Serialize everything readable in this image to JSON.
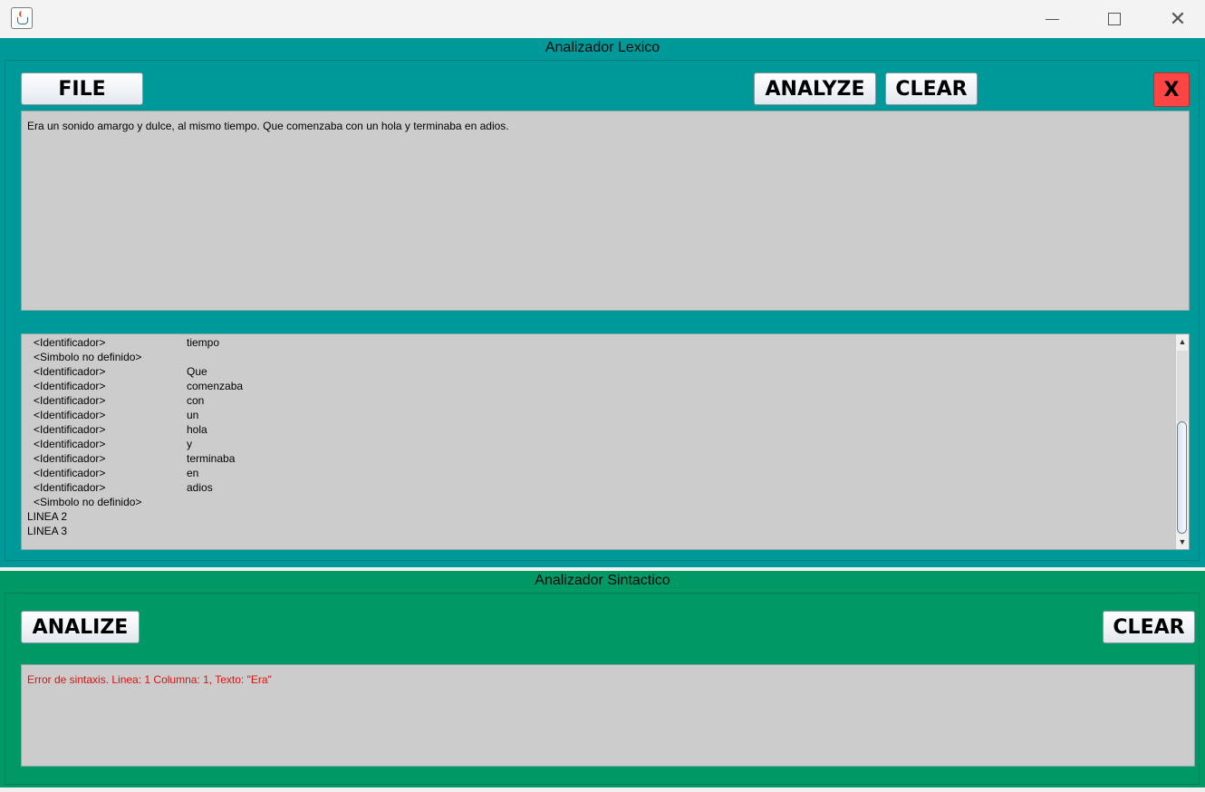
{
  "window": {
    "icon": "java-cup-icon",
    "controls": {
      "minimize": "minimize-icon",
      "maximize": "maximize-icon",
      "close": "close-icon"
    }
  },
  "lexico": {
    "title": "Analizador Lexico",
    "file_label": "FILE",
    "analyze_label": "ANALYZE",
    "clear_label": "CLEAR",
    "close_label": "X",
    "input_text": "Era un sonido amargo y dulce, al mismo tiempo. Que comenzaba con un hola y terminaba en adios.",
    "output_rows": [
      {
        "token": "<Identificador>",
        "value": "tiempo",
        "indent": true
      },
      {
        "token": "<Simbolo no definido>",
        "value": "",
        "indent": true
      },
      {
        "token": "<Identificador>",
        "value": "Que",
        "indent": true
      },
      {
        "token": "<Identificador>",
        "value": "comenzaba",
        "indent": true
      },
      {
        "token": "<Identificador>",
        "value": "con",
        "indent": true
      },
      {
        "token": "<Identificador>",
        "value": "un",
        "indent": true
      },
      {
        "token": "<Identificador>",
        "value": "hola",
        "indent": true
      },
      {
        "token": "<Identificador>",
        "value": "y",
        "indent": true
      },
      {
        "token": "<Identificador>",
        "value": "terminaba",
        "indent": true
      },
      {
        "token": "<Identificador>",
        "value": "en",
        "indent": true
      },
      {
        "token": "<Identificador>",
        "value": "adios",
        "indent": true
      },
      {
        "token": "<Simbolo no definido>",
        "value": "",
        "indent": true
      },
      {
        "token": "LINEA 2",
        "value": "",
        "indent": false
      },
      {
        "token": "LINEA 3",
        "value": "",
        "indent": false
      }
    ]
  },
  "sintactico": {
    "title": "Analizador Sintactico",
    "analize_label": "ANALIZE",
    "clear_label": "CLEAR",
    "error_text": "Error de sintaxis. Linea: 1 Columna: 1, Texto: \"Era\""
  },
  "colors": {
    "lexico_panel": "#009999",
    "sintactico_panel": "#009966",
    "text_area": "#cccccc",
    "close_button": "#ff4444",
    "error_text": "#dd1111"
  }
}
